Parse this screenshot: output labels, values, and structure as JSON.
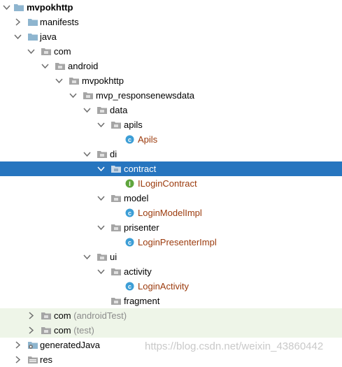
{
  "tree": {
    "root": "mvpokhttp",
    "manifests": "manifests",
    "java": "java",
    "com": "com",
    "android": "android",
    "mvpokhttp_pkg": "mvpokhttp",
    "mvp_responsenewsdata": "mvp_responsenewsdata",
    "data": "data",
    "apils_pkg": "apils",
    "apils_class": "Apils",
    "di": "di",
    "contract": "contract",
    "ilogincontract": "ILoginContract",
    "model": "model",
    "loginmodelimpl": "LoginModelImpl",
    "prisenter": "prisenter",
    "loginpresenterimpl": "LoginPresenterImpl",
    "ui": "ui",
    "activity": "activity",
    "loginactivity": "LoginActivity",
    "fragment": "fragment",
    "com_android_test": "com",
    "com_android_test_suffix": "(androidTest)",
    "com_test": "com",
    "com_test_suffix": "(test)",
    "generatedjava": "generatedJava",
    "res": "res"
  },
  "watermark": "https://blog.csdn.net/weixin_43860442",
  "colors": {
    "selected": "#2675bf",
    "test_bg": "#eef5e8",
    "class_text": "#9b3a0c",
    "class_icon": "#3d9ed6",
    "interface_icon": "#5fa53d"
  }
}
